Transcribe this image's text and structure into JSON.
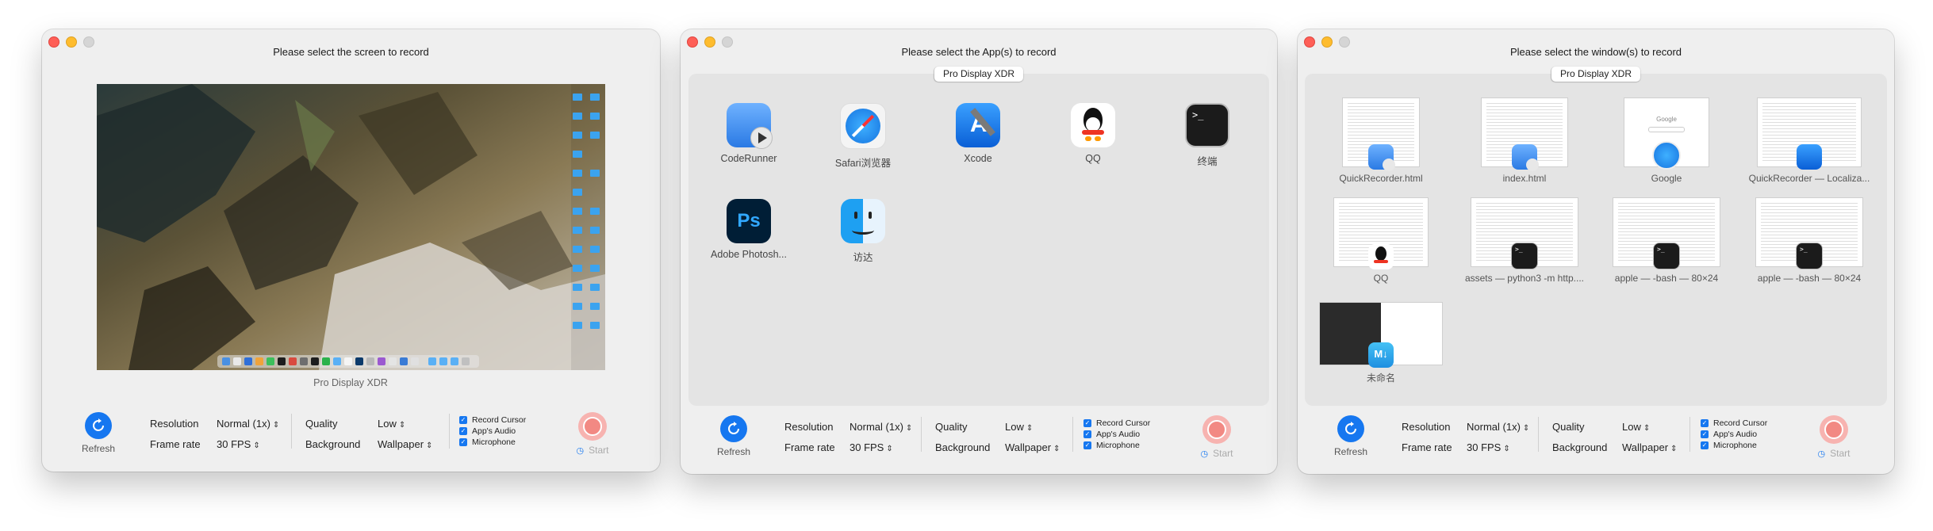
{
  "colors": {
    "accent": "#1677f0",
    "record": "#f28983",
    "traffic_red": "#fe5f57",
    "traffic_yellow": "#febc2e",
    "traffic_gray": "#d5d5d5"
  },
  "windows": [
    {
      "title": "Please select the screen to record",
      "screen_caption": "Pro Display XDR"
    },
    {
      "title": "Please select the App(s) to record",
      "display_button": "Pro Display XDR",
      "apps": [
        {
          "label": "CodeRunner",
          "icon": "coderunner-icon"
        },
        {
          "label": "Safari浏览器",
          "icon": "safari-icon"
        },
        {
          "label": "Xcode",
          "icon": "xcode-icon"
        },
        {
          "label": "QQ",
          "icon": "qq-penguin-icon"
        },
        {
          "label": "终端",
          "icon": "terminal-icon"
        },
        {
          "label": "Adobe Photosh...",
          "icon": "photoshop-icon",
          "glyph": "Ps"
        },
        {
          "label": "访达",
          "icon": "finder-icon"
        }
      ]
    },
    {
      "title": "Please select the window(s) to record",
      "display_button": "Pro Display XDR",
      "windows": [
        {
          "label": "QuickRecorder.html",
          "icon": "coderunner-icon"
        },
        {
          "label": "index.html",
          "icon": "coderunner-icon"
        },
        {
          "label": "Google",
          "icon": "safari-icon",
          "page_text": "Google"
        },
        {
          "label": "QuickRecorder — Localiza...",
          "icon": "xcode-icon"
        },
        {
          "label": "QQ",
          "icon": "qq-penguin-icon"
        },
        {
          "label": "assets — python3 -m http....",
          "icon": "terminal-icon"
        },
        {
          "label": "apple — -bash — 80×24",
          "icon": "terminal-icon"
        },
        {
          "label": "apple — -bash — 80×24",
          "icon": "terminal-icon"
        },
        {
          "label": "未命名",
          "icon": "markdown-icon",
          "glyph": "M↓"
        }
      ]
    }
  ],
  "controls": {
    "refresh_label": "Refresh",
    "resolution_label": "Resolution",
    "resolution_value": "Normal (1x)",
    "framerate_label": "Frame rate",
    "framerate_value": "30 FPS",
    "quality_label": "Quality",
    "quality_value": "Low",
    "background_label": "Background",
    "background_value": "Wallpaper",
    "record_cursor": "Record Cursor",
    "apps_audio": "App's Audio",
    "microphone": "Microphone",
    "start_label": "Start",
    "terminal_glyph": ">_"
  }
}
